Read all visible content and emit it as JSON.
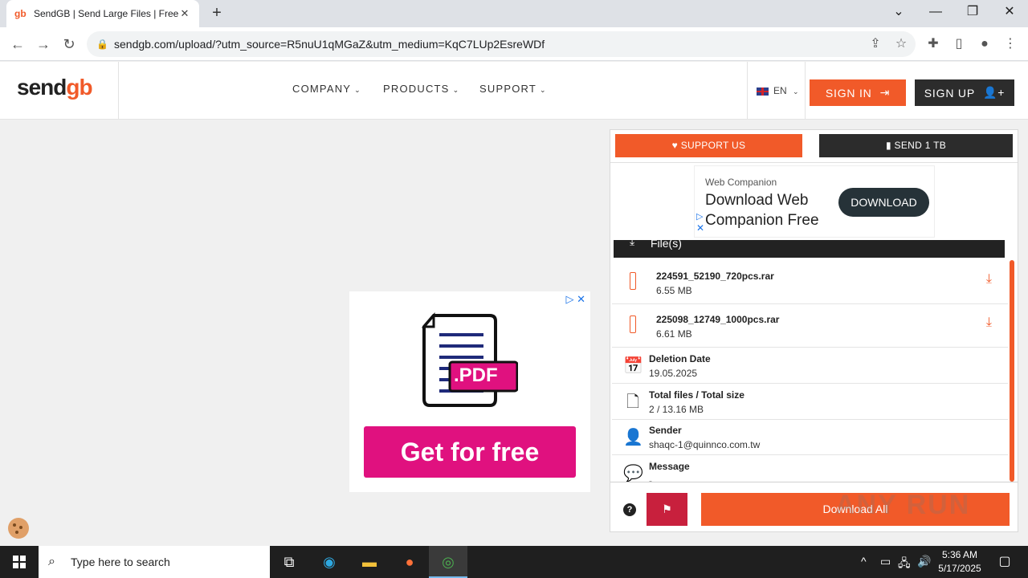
{
  "browser": {
    "tab_title": "SendGB | Send Large Files | Free f",
    "tab_close": "✕",
    "new_tab": "+",
    "url": "sendgb.com/upload/?utm_source=R5nuU1qMGaZ&utm_medium=KqC7LUp2EsreWDf",
    "window_controls": {
      "dropdown": "⌄",
      "minimize": "—",
      "restore": "❐",
      "close": "✕"
    }
  },
  "site": {
    "logo": {
      "part1": "send",
      "part2": "gb"
    },
    "menu": [
      {
        "label": "COMPANY"
      },
      {
        "label": "PRODUCTS"
      },
      {
        "label": "SUPPORT"
      }
    ],
    "language": "EN",
    "sign_in": "SIGN IN",
    "sign_up": "SIGN UP"
  },
  "ad_left": {
    "icon_label": ".PDF",
    "button": "Get for free"
  },
  "panel": {
    "support_us": "SUPPORT US",
    "send_1tb": "SEND 1 TB",
    "ad_top": {
      "brand": "Web Companion",
      "headline": "Download Web Companion Free",
      "button": "DOWNLOAD"
    },
    "files_header": "File(s)",
    "files": [
      {
        "name": "224591_52190_720pcs.rar",
        "size": "6.55 MB"
      },
      {
        "name": "225098_12749_1000pcs.rar",
        "size": "6.61 MB"
      }
    ],
    "info": [
      {
        "label": "Deletion Date",
        "value": "19.05.2025",
        "icon": "calendar-icon"
      },
      {
        "label": "Total files / Total size",
        "value": "2 / 13.16 MB",
        "icon": "file-icon"
      },
      {
        "label": "Sender",
        "value": "shaqc-1@quinnco.com.tw",
        "icon": "user-icon"
      },
      {
        "label": "Message",
        "value": "-",
        "icon": "message-icon"
      }
    ],
    "download_all": "Download All"
  },
  "watermark": "ANY RUN",
  "taskbar": {
    "search_placeholder": "Type here to search",
    "time": "5:36 AM",
    "date": "5/17/2025"
  }
}
